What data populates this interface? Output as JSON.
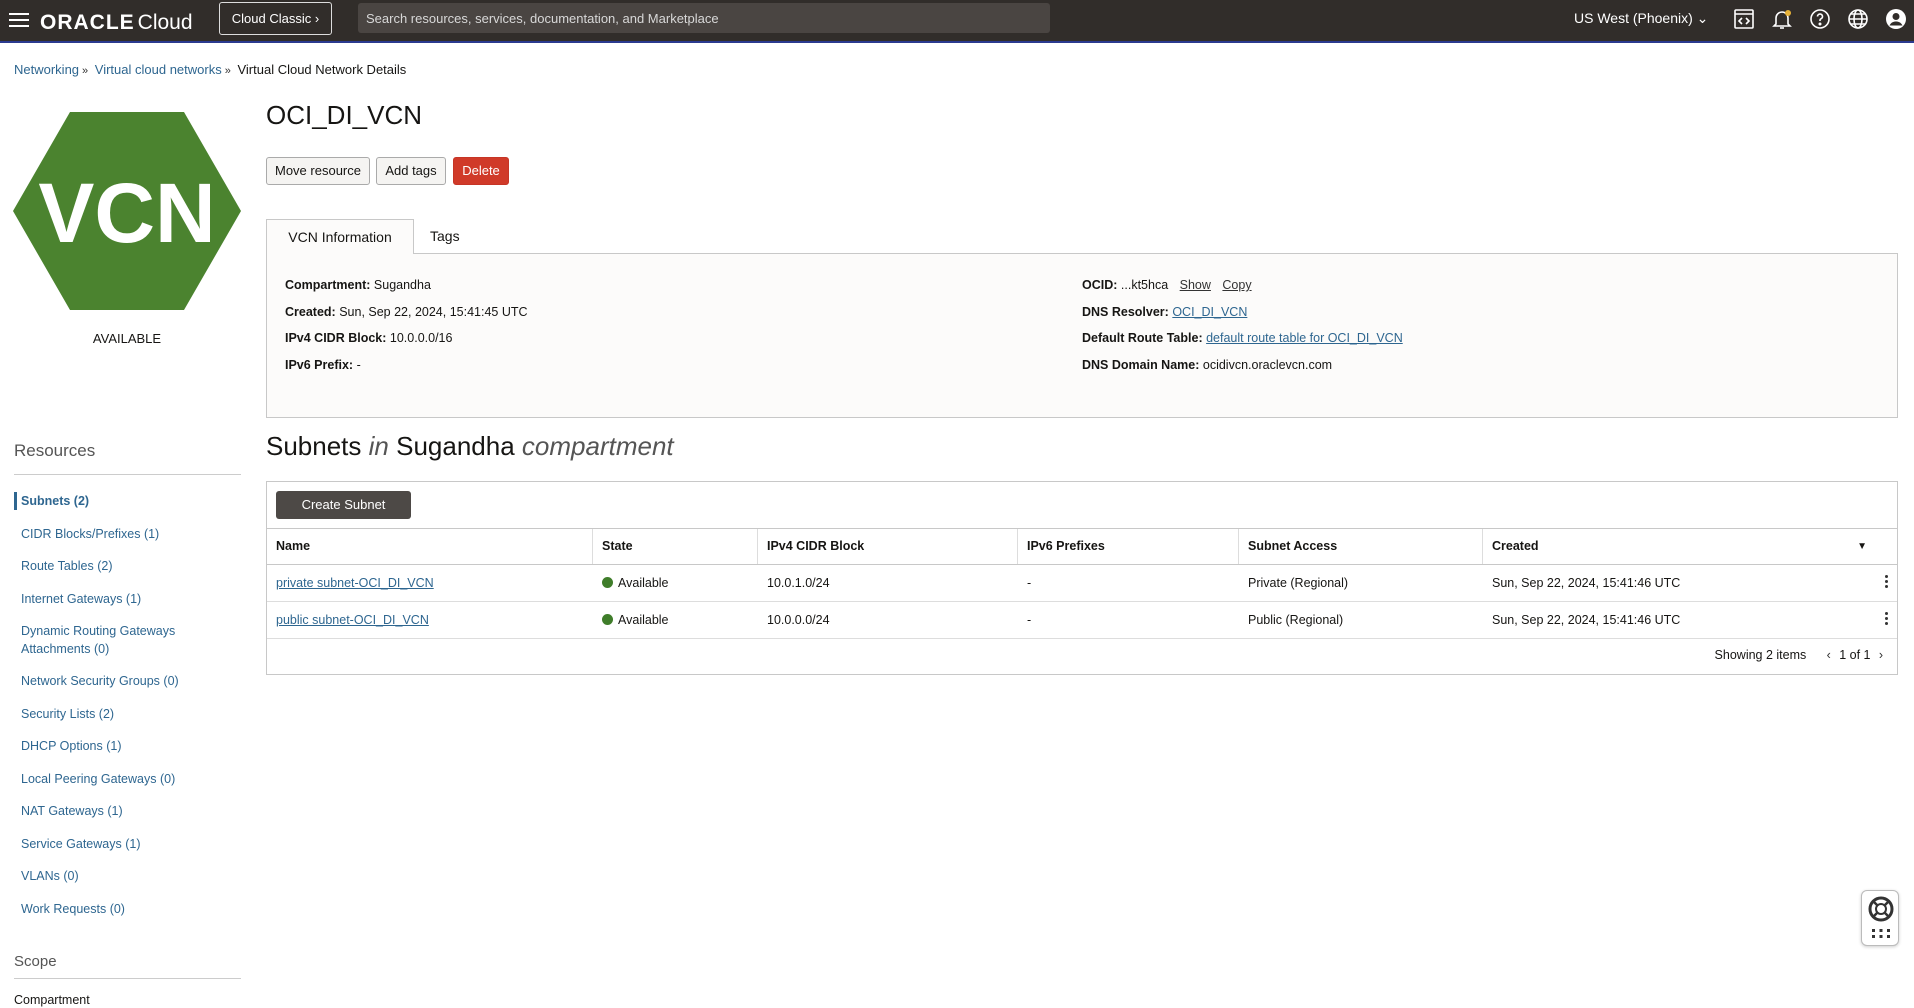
{
  "topbar": {
    "brand_oracle": "ORACLE",
    "brand_cloud": "Cloud",
    "classic_label": "Cloud Classic",
    "search_placeholder": "Search resources, services, documentation, and Marketplace",
    "region": "US West (Phoenix)",
    "icons": [
      "code-editor-icon",
      "bell-icon",
      "help-icon",
      "globe-icon",
      "user-icon"
    ]
  },
  "breadcrumb": {
    "items": [
      "Networking",
      "Virtual cloud networks"
    ],
    "current": "Virtual Cloud Network Details"
  },
  "badge": {
    "text": "VCN",
    "status": "AVAILABLE",
    "color": "#4b832f"
  },
  "page": {
    "title": "OCI_DI_VCN",
    "buttons": {
      "move": "Move resource",
      "tags": "Add tags",
      "delete": "Delete"
    }
  },
  "tabs": {
    "info": "VCN Information",
    "tags": "Tags"
  },
  "info": {
    "compartment_label": "Compartment:",
    "compartment": "Sugandha",
    "created_label": "Created:",
    "created": "Sun, Sep 22, 2024, 15:41:45 UTC",
    "cidr_label": "IPv4 CIDR Block:",
    "cidr": "10.0.0.0/16",
    "ipv6_label": "IPv6 Prefix:",
    "ipv6": "-",
    "ocid_label": "OCID:",
    "ocid": "...kt5hca",
    "show": "Show",
    "copy": "Copy",
    "dns_resolver_label": "DNS Resolver:",
    "dns_resolver": "OCI_DI_VCN",
    "route_table_label": "Default Route Table:",
    "route_table": "default route table for OCI_DI_VCN",
    "dns_domain_label": "DNS Domain Name:",
    "dns_domain": "ocidivcn.oraclevcn.com"
  },
  "subnets": {
    "title_a": "Subnets",
    "title_in": "in",
    "title_comp": "Sugandha",
    "title_b": "compartment",
    "create": "Create Subnet",
    "columns": [
      "Name",
      "State",
      "IPv4 CIDR Block",
      "IPv6 Prefixes",
      "Subnet Access",
      "Created"
    ],
    "rows": [
      {
        "name": "private subnet-OCI_DI_VCN",
        "state": "Available",
        "cidr": "10.0.1.0/24",
        "ipv6": "-",
        "access": "Private (Regional)",
        "created": "Sun, Sep 22, 2024, 15:41:46 UTC"
      },
      {
        "name": "public subnet-OCI_DI_VCN",
        "state": "Available",
        "cidr": "10.0.0.0/24",
        "ipv6": "-",
        "access": "Public (Regional)",
        "created": "Sun, Sep 22, 2024, 15:41:46 UTC"
      }
    ],
    "showing": "Showing 2 items",
    "page": "1 of 1"
  },
  "resources": {
    "title": "Resources",
    "items": [
      "Subnets (2)",
      "CIDR Blocks/Prefixes (1)",
      "Route Tables (2)",
      "Internet Gateways (1)",
      "Dynamic Routing Gateways Attachments (0)",
      "Network Security Groups (0)",
      "Security Lists (2)",
      "DHCP Options (1)",
      "Local Peering Gateways (0)",
      "NAT Gateways (1)",
      "Service Gateways (1)",
      "VLANs (0)",
      "Work Requests (0)"
    ]
  },
  "scope": {
    "title": "Scope",
    "label": "Compartment"
  }
}
